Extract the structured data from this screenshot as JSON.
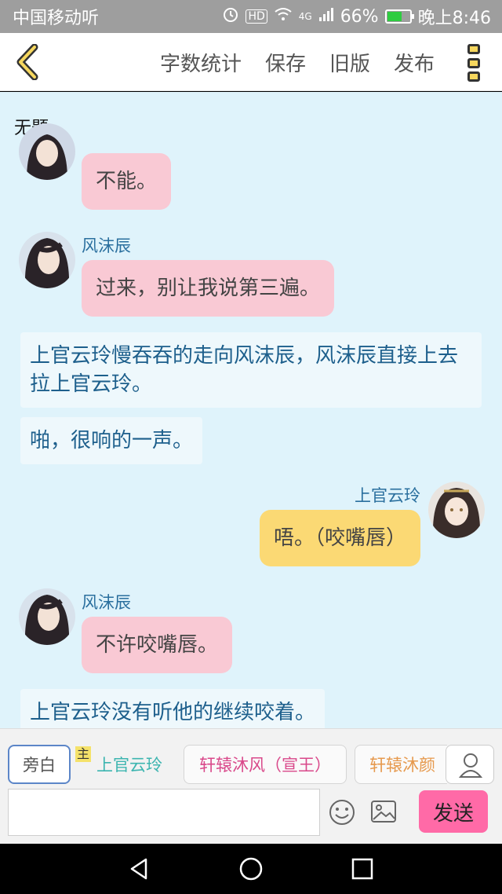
{
  "statusbar": {
    "carrier": "中国移动听",
    "hd": "HD",
    "signal": "4G",
    "battery": "66%",
    "battery_level": 0.66,
    "time": "晚上8:46"
  },
  "toolbar": {
    "word_count": "字数统计",
    "save": "保存",
    "old_version": "旧版",
    "publish": "发布"
  },
  "doc": {
    "title": "无题"
  },
  "messages": [
    {
      "type": "left",
      "name": "",
      "text": "不能。"
    },
    {
      "type": "left",
      "name": "风沫辰",
      "text": "过来，别让我说第三遍。"
    },
    {
      "type": "narration",
      "text": "上官云玲慢吞吞的走向风沫辰，风沫辰直接上去拉上官云玲。"
    },
    {
      "type": "narration",
      "text": "啪，很响的一声。"
    },
    {
      "type": "right",
      "name": "上官云玲",
      "text": "唔。（咬嘴唇）"
    },
    {
      "type": "left",
      "name": "风沫辰",
      "text": "不许咬嘴唇。"
    },
    {
      "type": "narration",
      "text": "上官云玲没有听他的继续咬着。"
    }
  ],
  "roles": [
    {
      "label": "旁白",
      "active": true
    },
    {
      "label": "上官云玲",
      "tag": "主"
    },
    {
      "label": "轩辕沐风（宣王）"
    },
    {
      "label": "轩辕沐颜"
    }
  ],
  "composer": {
    "placeholder": "",
    "send": "发送"
  },
  "colors": {
    "pink_bubble": "#f9c9d4",
    "yellow_bubble": "#fbd974",
    "send_button": "#ff6aa7",
    "chat_bg": "#dff3fb"
  }
}
